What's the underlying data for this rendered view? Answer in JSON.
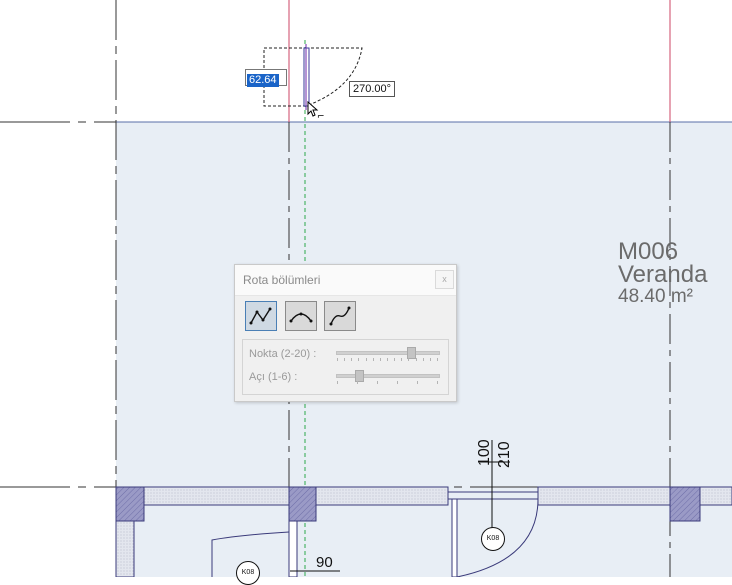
{
  "room": {
    "code": "M006",
    "name": "Veranda",
    "area": "48.40 m²"
  },
  "dimension_input": {
    "value": "62.64"
  },
  "angle_tag": {
    "value": "270.00°"
  },
  "door_tags": {
    "width": "100",
    "height": "210"
  },
  "dim_label": "90",
  "circle_tags": [
    "K08",
    "K08"
  ],
  "panel": {
    "title": "Rota bölümleri",
    "close_label": "x",
    "buttons": [
      "polyline-icon",
      "arc-icon",
      "curve-icon"
    ],
    "params": [
      {
        "label": "Nokta (2-20) :",
        "level": 0.75,
        "ticks": 15
      },
      {
        "label": "Açı (1-6) :",
        "level": 0.2,
        "ticks": 6
      }
    ]
  },
  "colors": {
    "room_fill": "#e8eef5",
    "wall_fill": "#9797c3",
    "accent_red": "#cc4466",
    "guide_green": "#2ca84a",
    "selection_blue": "#1a64c8"
  }
}
